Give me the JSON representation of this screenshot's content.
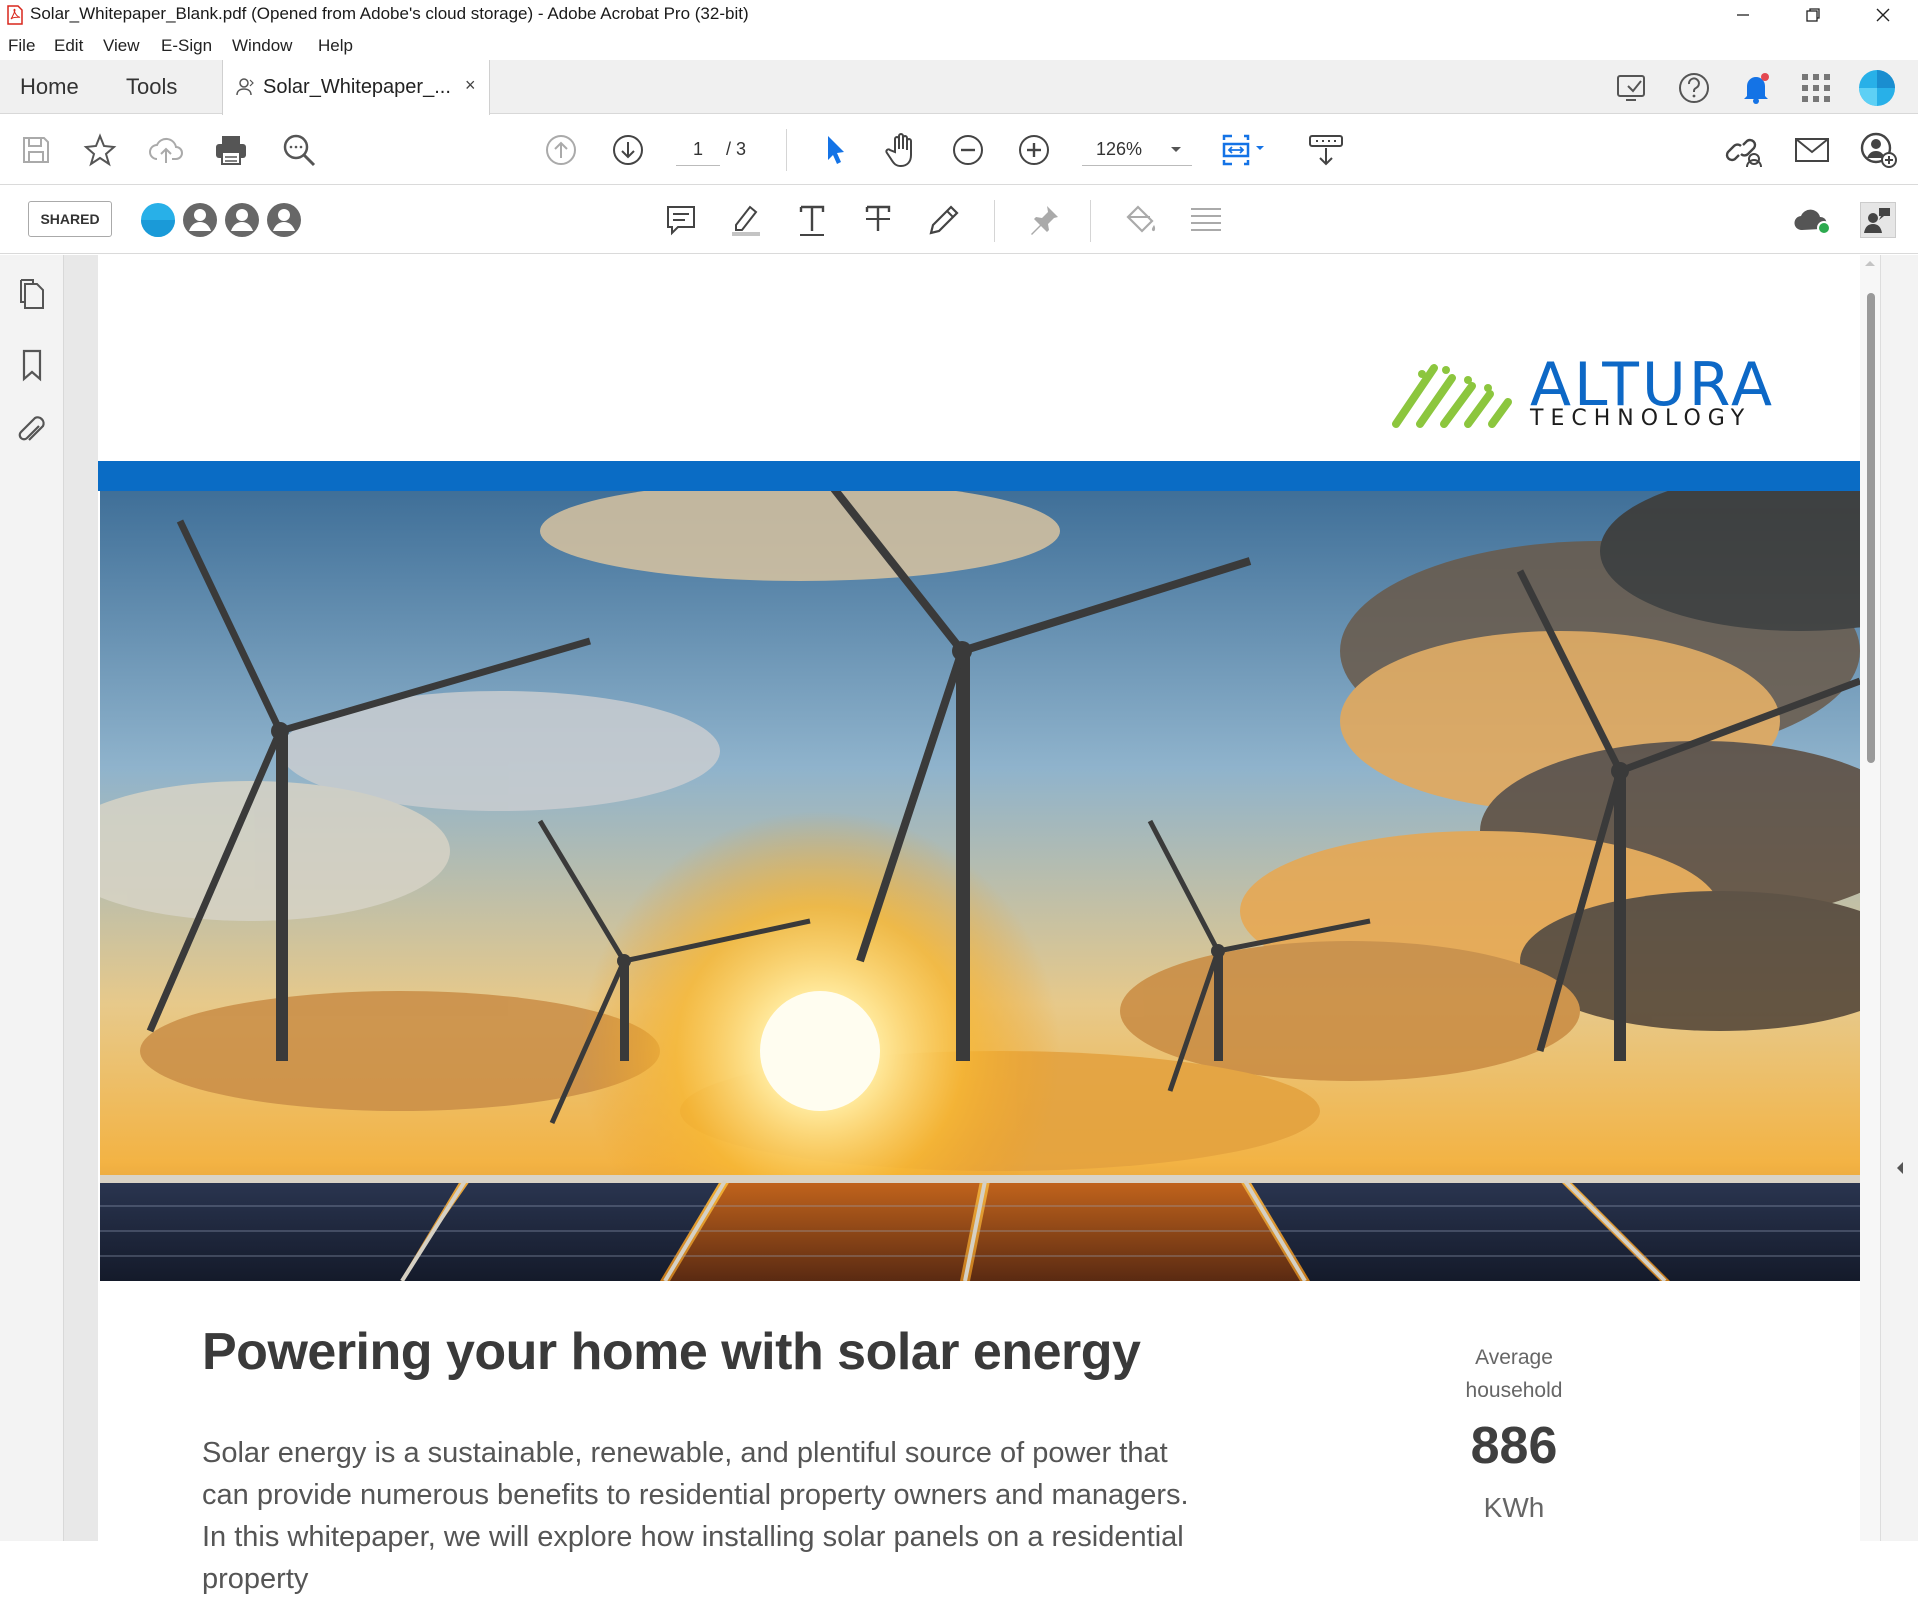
{
  "window": {
    "title": "Solar_Whitepaper_Blank.pdf (Opened from Adobe's cloud storage) - Adobe Acrobat Pro (32-bit)"
  },
  "menu": [
    "File",
    "Edit",
    "View",
    "E-Sign",
    "Window",
    "Help"
  ],
  "tabs": {
    "home": "Home",
    "tools": "Tools",
    "document": "Solar_Whitepaper_...",
    "close": "×"
  },
  "toolbar": {
    "current_page": "1",
    "total_pages": "/ 3",
    "zoom": "126%"
  },
  "subbar": {
    "shared_label": "SHARED"
  },
  "document": {
    "logo_name": "ALTURA",
    "logo_tagline": "TECHNOLOGY",
    "headline": "Powering your home with solar energy",
    "body": "Solar energy is a sustainable, renewable, and plentiful source of power that can provide numerous benefits to residential property owners and managers. In this whitepaper, we will explore how installing solar panels on a residential property",
    "stat_label_1": "Average",
    "stat_label_2": "household",
    "stat_value": "886",
    "stat_unit": "KWh"
  },
  "colors": {
    "accent_blue": "#0a6cc5",
    "logo_green": "#8cc63e",
    "tool_blue": "#1473e6"
  }
}
